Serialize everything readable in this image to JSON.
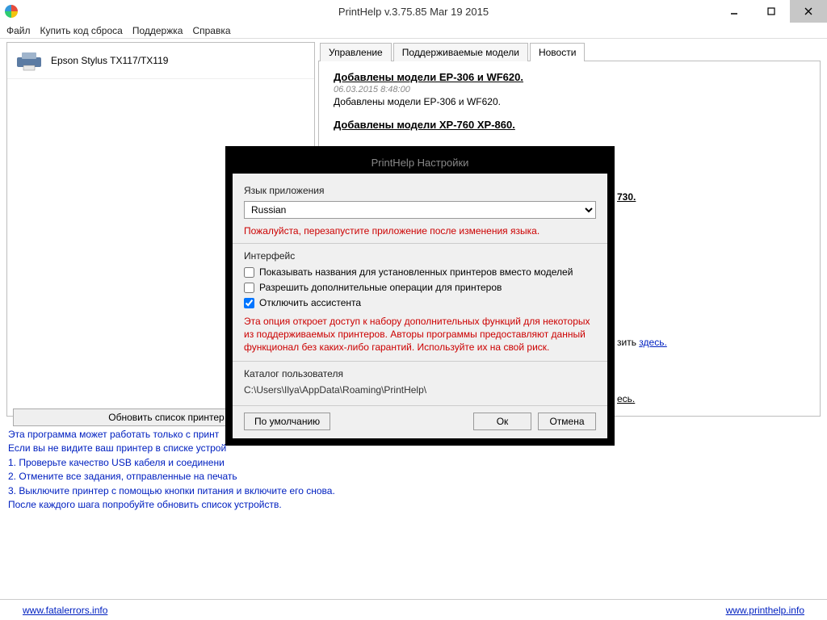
{
  "window": {
    "title": "PrintHelp v.3.75.85 Mar 19 2015"
  },
  "menu": {
    "file": "Файл",
    "buy": "Купить код сброса",
    "support": "Поддержка",
    "help": "Справка"
  },
  "printer": {
    "name": "Epson Stylus TX117/TX119"
  },
  "tabs": {
    "manage": "Управление",
    "supported": "Поддерживаемые модели",
    "news": "Новости"
  },
  "news": [
    {
      "title": "Добавлены модели EP-306 и WF620.",
      "date": "06.03.2015 8:48:00",
      "body": "Добавлены модели EP-306 и WF620."
    },
    {
      "title": "Добавлены модели XP-760 XP-860.",
      "date": "",
      "body": ""
    }
  ],
  "fragments": {
    "f1": "730.",
    "f2_pre": "зить ",
    "f2_link": "здесь.",
    "f3": "есь."
  },
  "refresh": "Обновить список принтер",
  "helptext": {
    "l1": "Эта программа может работать только с принт",
    "l2": "Если вы не видите ваш принтер в списке устрой",
    "l3": "1. Проверьте качество USB кабеля и соединени",
    "l4": "2. Отмените все задания, отправленные на печать",
    "l5": "3. Выключите принтер с помощью кнопки питания и включите его снова.",
    "l6": "После каждого шага попробуйте обновить список устройств."
  },
  "footer": {
    "left": "www.fatalerrors.info",
    "right": "www.printhelp.info"
  },
  "modal": {
    "title": "PrintHelp Настройки",
    "lang_label": "Язык приложения",
    "lang_value": "Russian",
    "lang_note": "Пожалуйста, перезапустите приложение после изменения языка.",
    "iface_label": "Интерфейс",
    "chk1": "Показывать названия для установленных принтеров вместо моделей",
    "chk2": "Разрешить дополнительные операции для принтеров",
    "chk3": "Отключить ассистента",
    "risk_note": "Эта опция откроет доступ к набору дополнительных функций для некоторых из поддерживаемых принтеров. Авторы программы предоставляют данный функционал без каких-либо гарантий. Используйте их на свой риск.",
    "catalog_label": "Каталог пользователя",
    "catalog_path": "C:\\Users\\Ilya\\AppData\\Roaming\\PrintHelp\\",
    "btn_default": "По умолчанию",
    "btn_ok": "Ок",
    "btn_cancel": "Отмена"
  }
}
